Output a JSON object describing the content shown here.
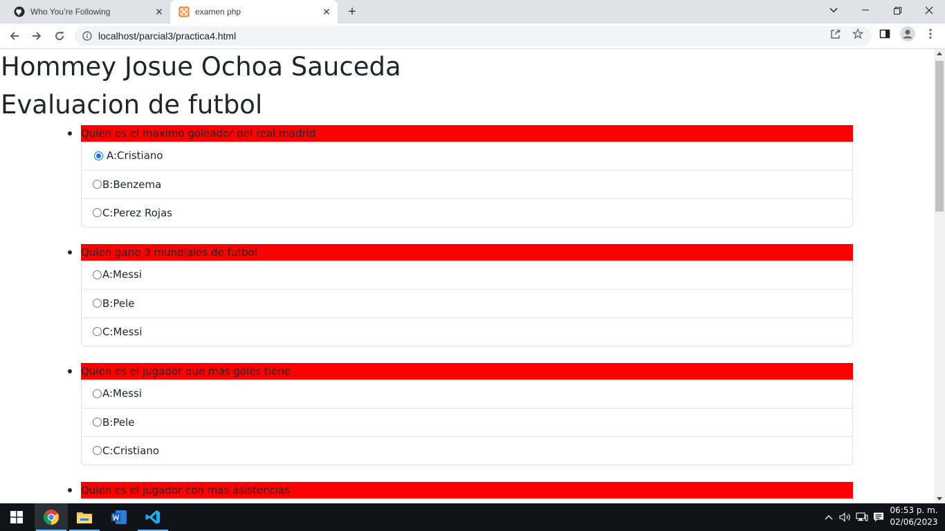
{
  "browser": {
    "tabs": [
      {
        "title": "Who You’re Following",
        "icon": "github-icon",
        "active": false
      },
      {
        "title": "examen php",
        "icon": "xampp-icon",
        "active": true
      }
    ],
    "url": "localhost/parcial3/practica4.html"
  },
  "page": {
    "heading_name": "Hommey Josue Ochoa Sauceda",
    "heading_title": "Evaluacion de futbol",
    "questions": [
      {
        "text": "Quien es el maximo goleador del real madrid",
        "options": [
          {
            "label": "A:Cristiano",
            "checked": true
          },
          {
            "label": "B:Benzema",
            "checked": false
          },
          {
            "label": "C:Perez Rojas",
            "checked": false
          }
        ]
      },
      {
        "text": "Quien gano 3 mundiales de futbol",
        "options": [
          {
            "label": "A:Messi",
            "checked": false
          },
          {
            "label": "B:Pele",
            "checked": false
          },
          {
            "label": "C:Messi",
            "checked": false
          }
        ]
      },
      {
        "text": "Quien es el jugador que mas goles tiene",
        "options": [
          {
            "label": "A:Messi",
            "checked": false
          },
          {
            "label": "B:Pele",
            "checked": false
          },
          {
            "label": "C:Cristiano",
            "checked": false
          }
        ]
      },
      {
        "text": "Quien es el jugador con mas asistencias",
        "options": []
      }
    ]
  },
  "taskbar": {
    "time": "06:53 p. m.",
    "date": "02/06/2023",
    "apps": [
      "windows-start-icon",
      "chrome-icon",
      "file-explorer-icon",
      "word-icon",
      "vscode-icon"
    ]
  },
  "colors": {
    "question_header_bg": "#ff0000",
    "radio_checked": "#0075ff",
    "taskbar_bg": "#101318"
  }
}
